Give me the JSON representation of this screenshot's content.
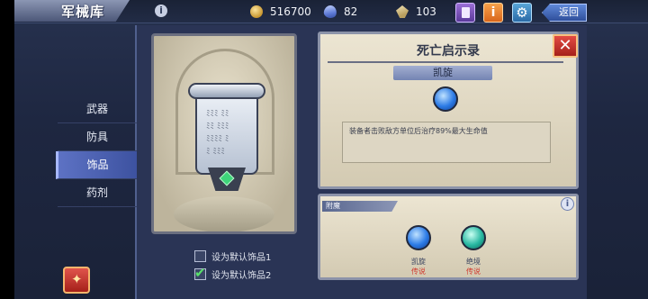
{
  "header": {
    "title": "军械库",
    "info_icon": "i",
    "coins": "516700",
    "gems": "82",
    "fragments": "103",
    "info_button": "i",
    "settings_icon": "⚙",
    "back_label": "返回"
  },
  "nav": {
    "items": [
      {
        "label": "武器"
      },
      {
        "label": "防具"
      },
      {
        "label": "饰品"
      },
      {
        "label": "药剂"
      }
    ],
    "active_index": 2
  },
  "default_slots": [
    {
      "label": "设为默认饰品1",
      "checked": false
    },
    {
      "label": "设为默认饰品2",
      "checked": true
    }
  ],
  "item": {
    "name": "死亡启示录",
    "close_icon": "✕",
    "skill_name": "凯旋",
    "description": "装备者击败敌方单位后治疗89%最大生命值"
  },
  "enchant": {
    "title": "附魔",
    "info_icon": "i",
    "slots": [
      {
        "name": "凯旋",
        "rarity": "传说",
        "color": "#2c7be6"
      },
      {
        "name": "绝境",
        "rarity": "传说",
        "color": "#28b8a2"
      }
    ]
  },
  "colors": {
    "accent": "#3d52a0",
    "rarity_legendary": "#d03a2f",
    "checkbox_on": "#59e06b"
  }
}
